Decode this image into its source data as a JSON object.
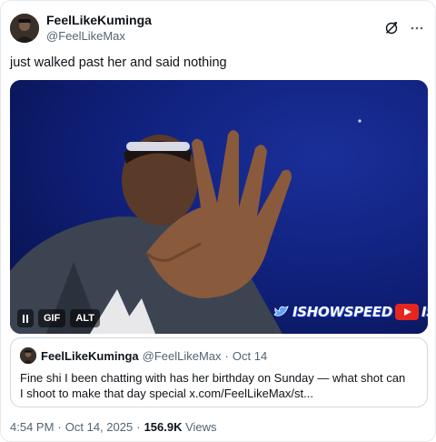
{
  "author": {
    "display_name": "FeelLikeKuminga",
    "handle": "@FeelLikeMax",
    "avatar_icon": "profile-photo"
  },
  "header_icons": [
    "grok-icon",
    "more-icon"
  ],
  "tweet": {
    "text": "just walked past her and said nothing"
  },
  "media": {
    "type": "gif",
    "gif_label": "GIF",
    "alt_label": "ALT",
    "watermark": "ISHOWSPEED",
    "watermark_tail": "IS"
  },
  "quote": {
    "display_name": "FeelLikeKuminga",
    "handle": "@FeelLikeMax",
    "dot": "·",
    "date": "Oct 14",
    "text": "Fine shi I been chatting with has her birthday on Sunday — what shot can I shoot to make that day special x.com/FeelLikeMax/st..."
  },
  "meta": {
    "time": "4:54 PM",
    "dot1": "·",
    "date": "Oct 14, 2025",
    "dot2": "·",
    "views_count": "156.9K",
    "views_label": "Views"
  },
  "colors": {
    "text_primary": "#0f1419",
    "text_secondary": "#536471",
    "border": "#cfd9de",
    "media_bg": "#0c1a5c"
  }
}
